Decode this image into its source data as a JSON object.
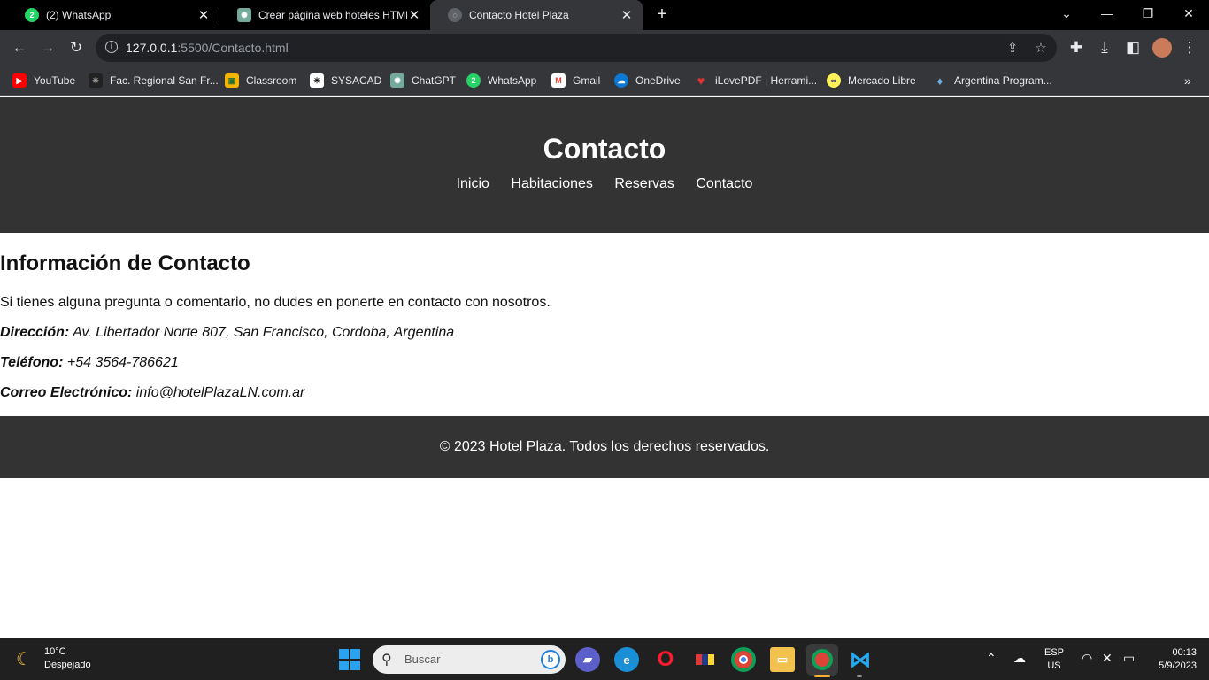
{
  "browser": {
    "tabs": [
      {
        "title": "(2) WhatsApp",
        "favicon": "whatsapp-icon",
        "badge": "2",
        "active": false
      },
      {
        "title": "Crear página web hoteles HTML/",
        "favicon": "chatgpt-icon",
        "active": false
      },
      {
        "title": "Contacto Hotel Plaza",
        "favicon": "globe-icon",
        "active": true
      }
    ],
    "address_host": "127.0.0.1",
    "address_path": ":5500/Contacto.html",
    "bookmarks": [
      {
        "label": "YouTube",
        "icon": "youtube-icon",
        "color": "#ff0000"
      },
      {
        "label": "Fac. Regional San Fr...",
        "icon": "utn-icon",
        "color": "#222222"
      },
      {
        "label": "Classroom",
        "icon": "classroom-icon",
        "color": "#f4b400"
      },
      {
        "label": "SYSACAD",
        "icon": "sysacad-icon",
        "color": "#222222"
      },
      {
        "label": "ChatGPT",
        "icon": "chatgpt-icon",
        "color": "#74aa9c"
      },
      {
        "label": "WhatsApp",
        "icon": "whatsapp-icon",
        "color": "#25d366"
      },
      {
        "label": "Gmail",
        "icon": "gmail-icon",
        "color": "#ea4335"
      },
      {
        "label": "OneDrive",
        "icon": "onedrive-icon",
        "color": "#0a78d4"
      },
      {
        "label": "iLovePDF | Herrami...",
        "icon": "ilovepdf-icon",
        "color": "#e5322d"
      },
      {
        "label": "Mercado Libre",
        "icon": "mercadolibre-icon",
        "color": "#fff159"
      },
      {
        "label": "Argentina Program...",
        "icon": "argentina-program-icon",
        "color": "#6cace4"
      }
    ]
  },
  "page": {
    "header_title": "Contacto",
    "nav": [
      "Inicio",
      "Habitaciones",
      "Reservas",
      "Contacto"
    ],
    "section_title": "Información de Contacto",
    "intro": "Si tienes alguna pregunta o comentario, no dudes en ponerte en contacto con nosotros.",
    "address_label": "Dirección:",
    "address_value": " Av. Libertador Norte 807, San Francisco, Cordoba, Argentina",
    "phone_label": "Teléfono:",
    "phone_value": " +54 3564-786621",
    "email_label": "Correo Electrónico:",
    "email_value": " info@hotelPlazaLN.com.ar",
    "footer": "© 2023 Hotel Plaza. Todos los derechos reservados."
  },
  "taskbar": {
    "weather_temp": "10°C",
    "weather_desc": "Despejado",
    "search_placeholder": "Buscar",
    "lang_1": "ESP",
    "lang_2": "US",
    "time": "00:13",
    "date": "5/9/2023"
  },
  "colors": {
    "header_bg": "#333333",
    "chrome_bg": "#35363a",
    "taskbar_bg": "#202020"
  }
}
